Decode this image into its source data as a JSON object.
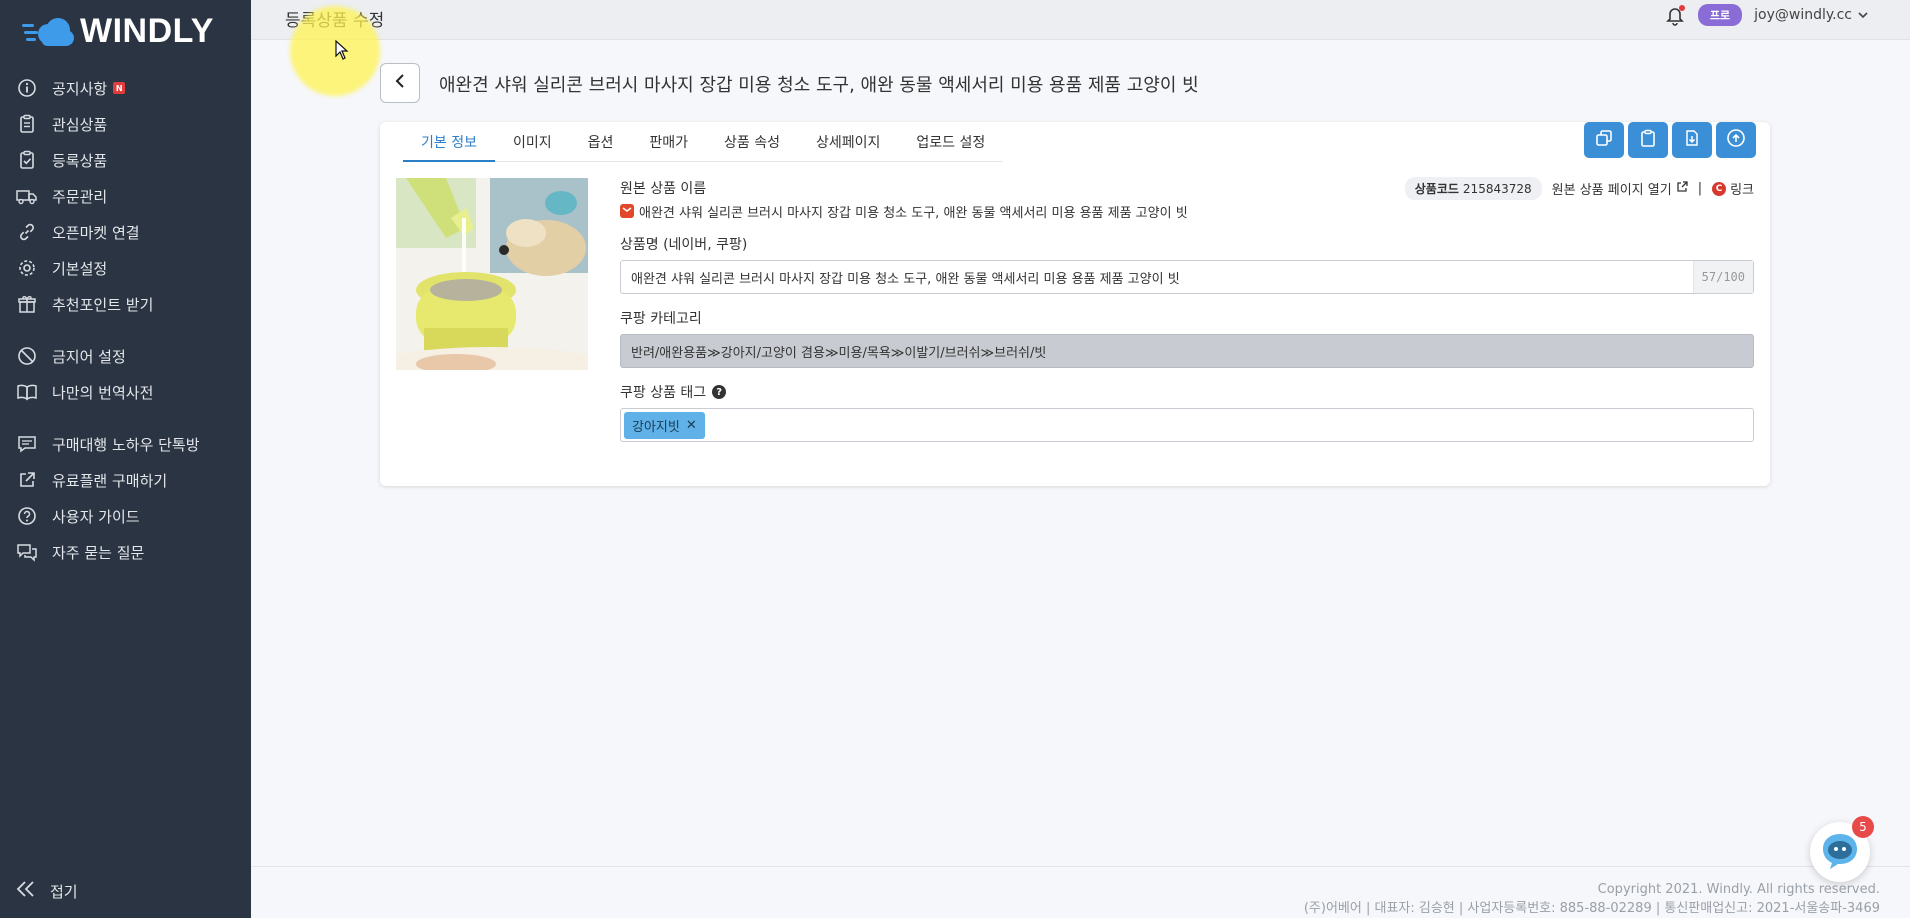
{
  "app": {
    "logo_text": "WINDLY",
    "colors": {
      "sidebar_bg": "#2b3442",
      "accent": "#3a8fd6",
      "tag_bg": "#5fb1e8",
      "pro_badge": "#8a6cd6"
    }
  },
  "sidebar": {
    "items": [
      {
        "label": "공지사항",
        "icon": "info-icon",
        "badge": "N"
      },
      {
        "label": "관심상품",
        "icon": "clipboard-icon"
      },
      {
        "label": "등록상품",
        "icon": "clipboard-check-icon"
      },
      {
        "label": "주문관리",
        "icon": "truck-icon"
      },
      {
        "label": "오픈마켓 연결",
        "icon": "link-icon"
      },
      {
        "label": "기본설정",
        "icon": "gear-icon"
      },
      {
        "label": "추천포인트 받기",
        "icon": "gift-icon"
      },
      {
        "label": "금지어 설정",
        "icon": "ban-icon"
      },
      {
        "label": "나만의 번역사전",
        "icon": "book-icon"
      },
      {
        "label": "구매대행 노하우 단톡방",
        "icon": "chat-icon"
      },
      {
        "label": "유료플랜 구매하기",
        "icon": "external-link-icon"
      },
      {
        "label": "사용자 가이드",
        "icon": "question-icon"
      },
      {
        "label": "자주 묻는 질문",
        "icon": "chat-bubbles-icon"
      }
    ],
    "collapse_label": "접기"
  },
  "header": {
    "title": "등록상품 수정",
    "pro_badge": "프로",
    "user_email": "joy@windly.cc"
  },
  "product": {
    "title": "애완견 샤워 실리콘 브러시 마사지 장갑 미용 청소 도구, 애완 동물 액세서리 미용 용품 제품 고양이 빗"
  },
  "tabs": [
    {
      "label": "기본 정보",
      "active": true
    },
    {
      "label": "이미지"
    },
    {
      "label": "옵션"
    },
    {
      "label": "판매가"
    },
    {
      "label": "상품 속성"
    },
    {
      "label": "상세페이지"
    },
    {
      "label": "업로드 설정"
    }
  ],
  "toolbar": {
    "buttons": [
      "copy-icon",
      "clipboard-icon",
      "download-icon",
      "upload-cloud-icon"
    ]
  },
  "basic_info": {
    "orig_name_label": "원본 상품 이름",
    "orig_name": "애완견 샤워 실리콘 브러시 마사지 장갑 미용 청소 도구, 애완 동물 액세서리 미용 용품 제품 고양이 빗",
    "code_label": "상품코드",
    "code_value": "215843728",
    "open_source_label": "원본 상품 페이지 열기",
    "separator": "|",
    "link_label": "링크",
    "name_label": "상품명 (네이버, 쿠팡)",
    "name_value": "애완견 샤워 실리콘 브러시 마사지 장갑 미용 청소 도구, 애완 동물 액세서리 미용 용품 제품 고양이 빗",
    "name_counter": "57/100",
    "category_label": "쿠팡 카테고리",
    "category_value": "반려/애완용품≫강아지/고양이 겸용≫미용/목욕≫이발기/브러쉬≫브러쉬/빗",
    "tag_label": "쿠팡 상품 태그",
    "tags": [
      "강아지빗"
    ]
  },
  "footer": {
    "copyright": "Copyright 2021. Windly. All rights reserved.",
    "company": "(주)어베어 | 대표자: 김승현 | 사업자등록번호: 885-88-02289 | 통신판매업신고: 2021-서울송파-3469"
  },
  "chat": {
    "count": "5"
  }
}
